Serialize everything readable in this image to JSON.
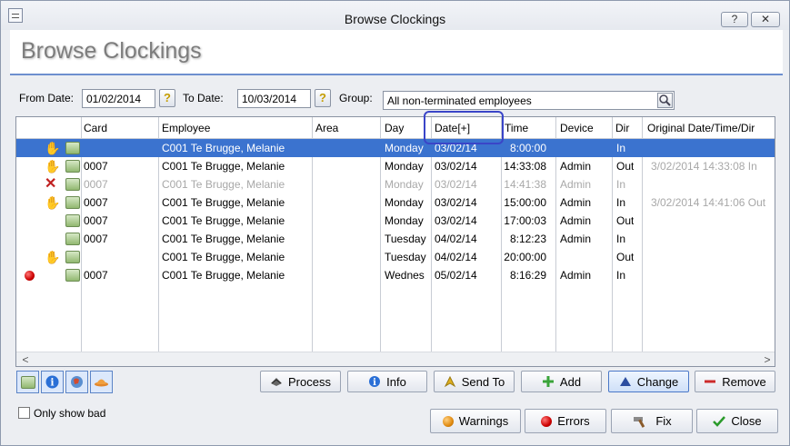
{
  "window": {
    "title": "Browse Clockings",
    "help_label": "?",
    "close_label": "✕"
  },
  "page_title": "Browse Clockings",
  "filters": {
    "from_label": "From Date:",
    "from_value": "01/02/2014",
    "to_label": "To Date:",
    "to_value": "10/03/2014",
    "group_label": "Group:",
    "group_value": "All non-terminated employees"
  },
  "grid": {
    "columns": [
      "Card",
      "Employee",
      "Area",
      "Day",
      "Date[+]",
      "Time",
      "Device",
      "Dir",
      "Original Date/Time/Dir"
    ],
    "rows": [
      {
        "status": "hand",
        "card": "",
        "employee": "C001 Te Brugge, Melanie",
        "area": "",
        "day": "Monday",
        "date": "03/02/14",
        "time": "8:00:00",
        "device": "",
        "dir": "In",
        "original": "",
        "style": "sel"
      },
      {
        "status": "hand",
        "card": "0007",
        "employee": "C001 Te Brugge, Melanie",
        "area": "",
        "day": "Monday",
        "date": "03/02/14",
        "time": "14:33:08",
        "device": "Admin",
        "dir": "Out",
        "original": "3/02/2014 14:33:08 In",
        "style": ""
      },
      {
        "status": "x",
        "card": "0007",
        "employee": "C001 Te Brugge, Melanie",
        "area": "",
        "day": "Monday",
        "date": "03/02/14",
        "time": "14:41:38",
        "device": "Admin",
        "dir": "In",
        "original": "",
        "style": "dim"
      },
      {
        "status": "hand",
        "card": "0007",
        "employee": "C001 Te Brugge, Melanie",
        "area": "",
        "day": "Monday",
        "date": "03/02/14",
        "time": "15:00:00",
        "device": "Admin",
        "dir": "In",
        "original": "3/02/2014 14:41:06 Out",
        "style": ""
      },
      {
        "status": "",
        "card": "0007",
        "employee": "C001 Te Brugge, Melanie",
        "area": "",
        "day": "Monday",
        "date": "03/02/14",
        "time": "17:00:03",
        "device": "Admin",
        "dir": "Out",
        "original": "",
        "style": ""
      },
      {
        "status": "",
        "card": "0007",
        "employee": "C001 Te Brugge, Melanie",
        "area": "",
        "day": "Tuesday",
        "date": "04/02/14",
        "time": "8:12:23",
        "device": "Admin",
        "dir": "In",
        "original": "",
        "style": ""
      },
      {
        "status": "hand",
        "card": "",
        "employee": "C001 Te Brugge, Melanie",
        "area": "",
        "day": "Tuesday",
        "date": "04/02/14",
        "time": "20:00:00",
        "device": "",
        "dir": "Out",
        "original": "",
        "style": ""
      },
      {
        "status": "red",
        "card": "0007",
        "employee": "C001 Te Brugge, Melanie",
        "area": "",
        "day": "Wednes",
        "date": "05/02/14",
        "time": "8:16:29",
        "device": "Admin",
        "dir": "In",
        "original": "",
        "style": ""
      }
    ]
  },
  "scroll": {
    "left": "<",
    "right": ">"
  },
  "actions": {
    "process": "Process",
    "info": "Info",
    "send_to": "Send To",
    "add": "Add",
    "change": "Change",
    "remove": "Remove",
    "warnings": "Warnings",
    "errors": "Errors",
    "fix": "Fix",
    "close": "Close"
  },
  "only_show_bad": "Only show bad",
  "colors": {
    "selection": "#3b73cf",
    "accent_line": "#6d8fcf",
    "highlight_box": "#3a45c8"
  }
}
